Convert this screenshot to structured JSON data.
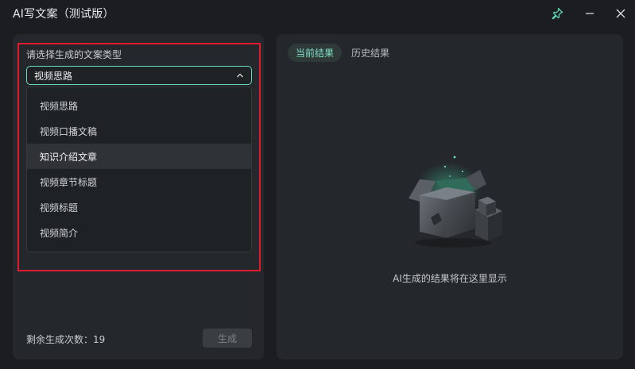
{
  "window": {
    "title": "AI写文案（测试版）",
    "controls": {
      "pin_icon": "pin-icon",
      "minimize_icon": "minimize-icon",
      "close_icon": "close-icon"
    },
    "accent": "#66d9bd"
  },
  "left": {
    "type_label": "请选择生成的文案类型",
    "select": {
      "value": "视频思路",
      "chevron_icon": "chevron-up-icon"
    },
    "options": [
      {
        "label": "视频思路"
      },
      {
        "label": "视频口播文稿"
      },
      {
        "label": "知识介绍文章",
        "hovered": true
      },
      {
        "label": "视频章节标题"
      },
      {
        "label": "视频标题"
      },
      {
        "label": "视频简介"
      }
    ],
    "remaining": "剩余生成次数：19",
    "generate_button": "生成",
    "highlight_color": "#e01b2f"
  },
  "right": {
    "tabs": [
      {
        "label": "当前结果",
        "active": true
      },
      {
        "label": "历史结果",
        "active": false
      }
    ],
    "empty_icon": "open-box-icon",
    "empty_text": "AI生成的结果将在这里显示"
  }
}
